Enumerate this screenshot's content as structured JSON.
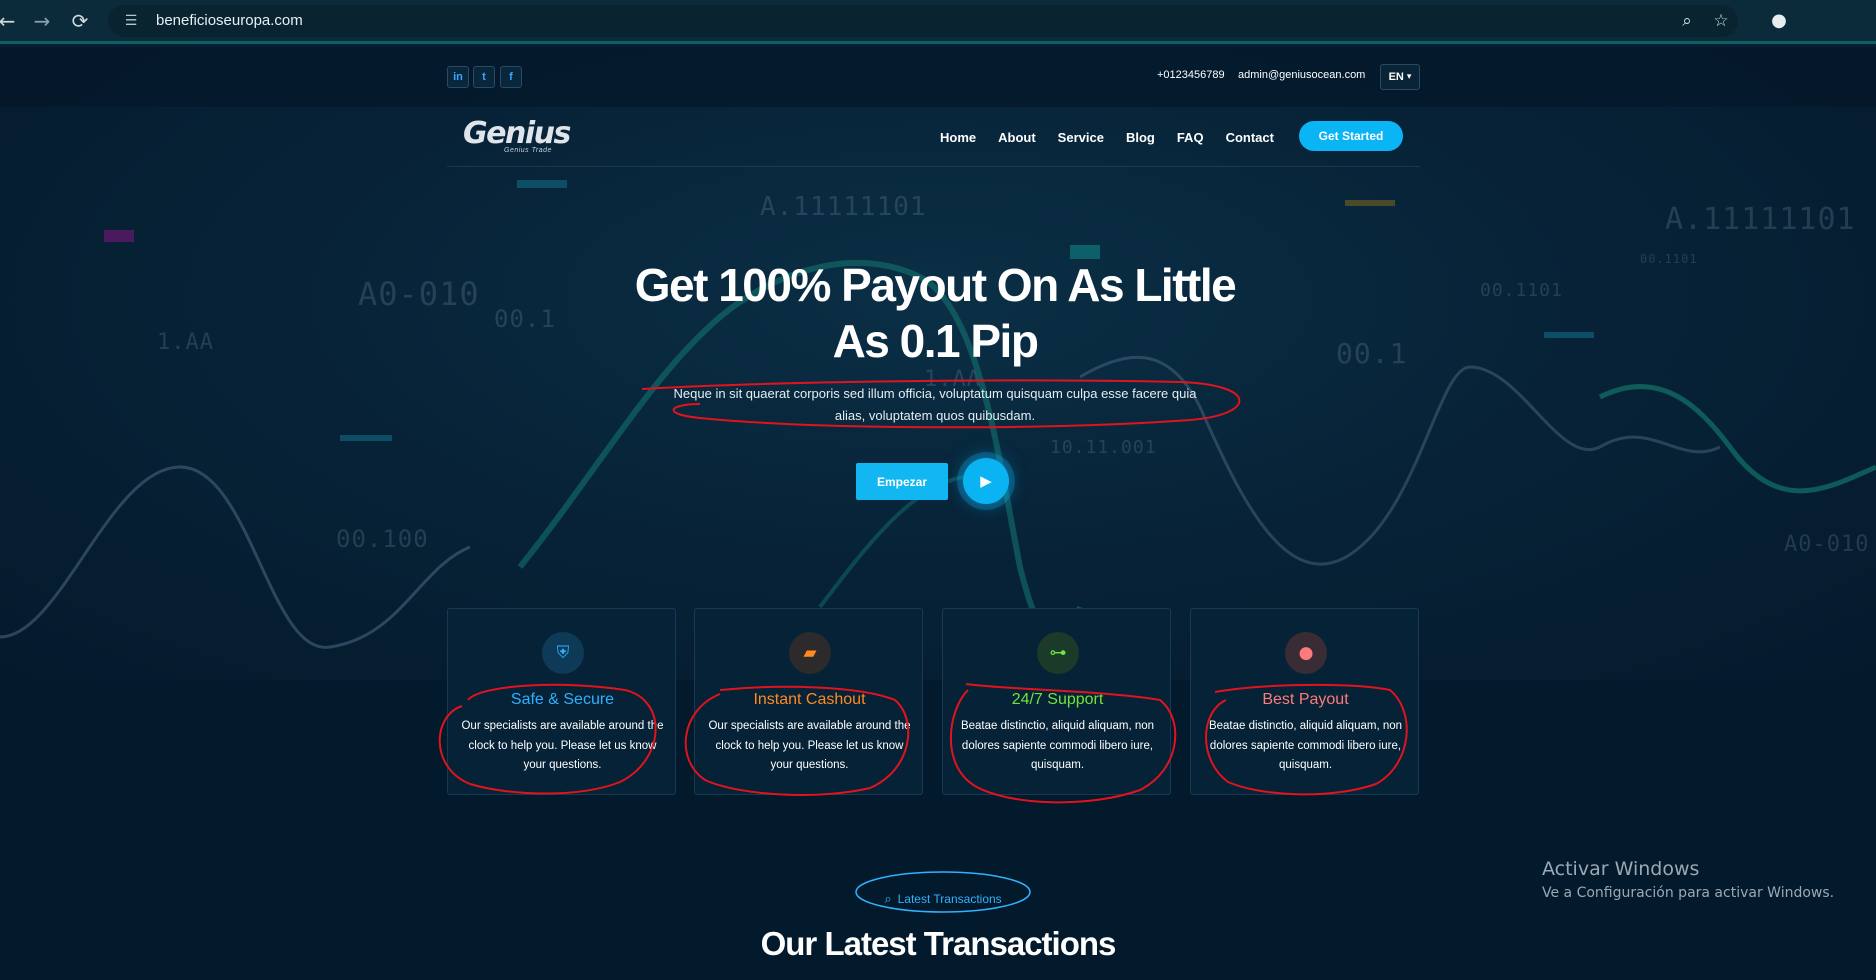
{
  "browser": {
    "url": "beneficioseuropa.com",
    "icons": {
      "back": "arrow-left-icon",
      "forward": "arrow-right-icon",
      "reload": "reload-icon",
      "site_info": "tune-icon",
      "zoom": "zoom-icon",
      "bookmark": "star-icon",
      "profile": "person-icon"
    }
  },
  "topbar": {
    "social": [
      {
        "name": "linkedin",
        "glyph": "in"
      },
      {
        "name": "twitter",
        "glyph": "t"
      },
      {
        "name": "facebook",
        "glyph": "f"
      }
    ],
    "phone": "+0123456789",
    "email": "admin@geniusocean.com",
    "language": "EN"
  },
  "navbar": {
    "logo_text": "Genius",
    "logo_sub": "Genius Trade",
    "links": [
      "Home",
      "About",
      "Service",
      "Blog",
      "FAQ",
      "Contact"
    ],
    "cta": "Get Started"
  },
  "hero": {
    "title_line1": "Get 100% Payout On As Little",
    "title_line2": "As 0.1 Pip",
    "subtitle": "Neque in sit quaerat corporis sed illum officia, voluptatum quisquam culpa esse facere quia alias, voluptatem quos quibusdam.",
    "cta": "Empezar",
    "background_numbers": [
      "A.11111101",
      "A0-010",
      "00.1",
      "1.AA",
      "00.100",
      "1.AA",
      "10.11.001",
      "00.1",
      "00.1101",
      "A.11111101",
      "00.1101",
      "A0-010"
    ]
  },
  "features": [
    {
      "title": "Safe & Secure",
      "text": "Our specialists are available around the clock to help you. Please let us know your questions.",
      "icon": "shield-icon",
      "color": "#2fb0ff"
    },
    {
      "title": "Instant Cashout",
      "text": "Our specialists are available around the clock to help you. Please let us know your questions.",
      "icon": "wallet-icon",
      "color": "#ff8a1f"
    },
    {
      "title": "24/7 Support",
      "text": "Beatae distinctio, aliquid aliquam, non dolores sapiente commodi libero iure, quisquam.",
      "icon": "network-icon",
      "color": "#6fe43a"
    },
    {
      "title": "Best Payout",
      "text": "Beatae distinctio, aliquid aliquam, non dolores sapiente commodi libero iure, quisquam.",
      "icon": "piggy-bank-icon",
      "color": "#ff7a7a"
    }
  ],
  "section": {
    "tag": "Latest Transactions",
    "title": "Our Latest Transactions"
  },
  "windows": {
    "title": "Activar Windows",
    "subtitle": "Ve a Configuración para activar Windows."
  },
  "colors": {
    "accent": "#0bb4f5",
    "annotation": "#e0141e",
    "background": "#041a2e"
  }
}
